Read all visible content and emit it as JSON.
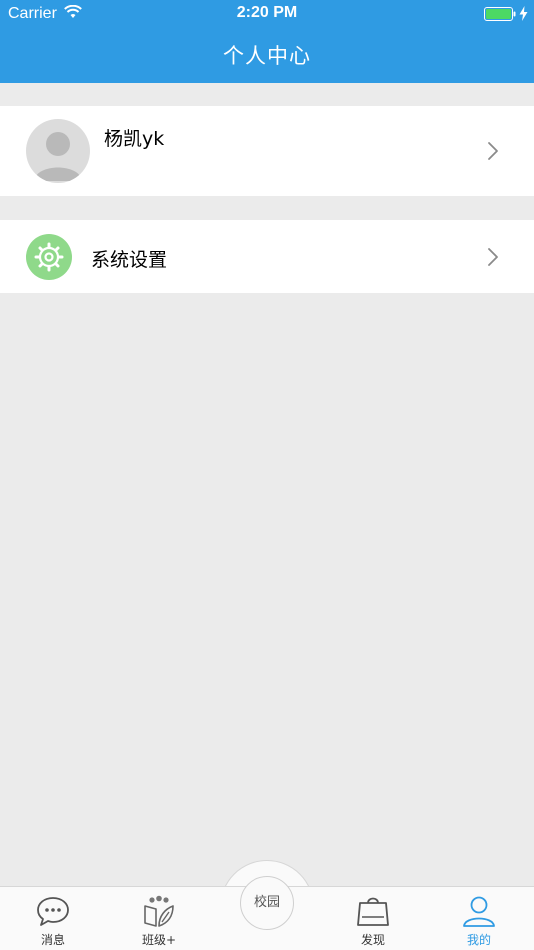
{
  "status_bar": {
    "carrier": "Carrier",
    "time": "2:20 PM"
  },
  "nav": {
    "title": "个人中心"
  },
  "profile": {
    "name": "杨凯yk"
  },
  "menu": {
    "settings_label": "系统设置"
  },
  "tabbar": {
    "tabs": [
      {
        "label": "消息",
        "icon": "chat-bubble-icon",
        "active": false
      },
      {
        "label": "班级+",
        "icon": "class-book-icon",
        "active": false
      },
      {
        "label": "校园",
        "icon": "campus-center-button",
        "active": false
      },
      {
        "label": "发现",
        "icon": "shopping-bag-icon",
        "active": false
      },
      {
        "label": "我的",
        "icon": "person-icon",
        "active": true
      }
    ]
  },
  "colors": {
    "nav_blue": "#2f9be3",
    "background_gray": "#ebebeb",
    "settings_green": "#8fd98a",
    "active_tab": "#2f9be3"
  }
}
